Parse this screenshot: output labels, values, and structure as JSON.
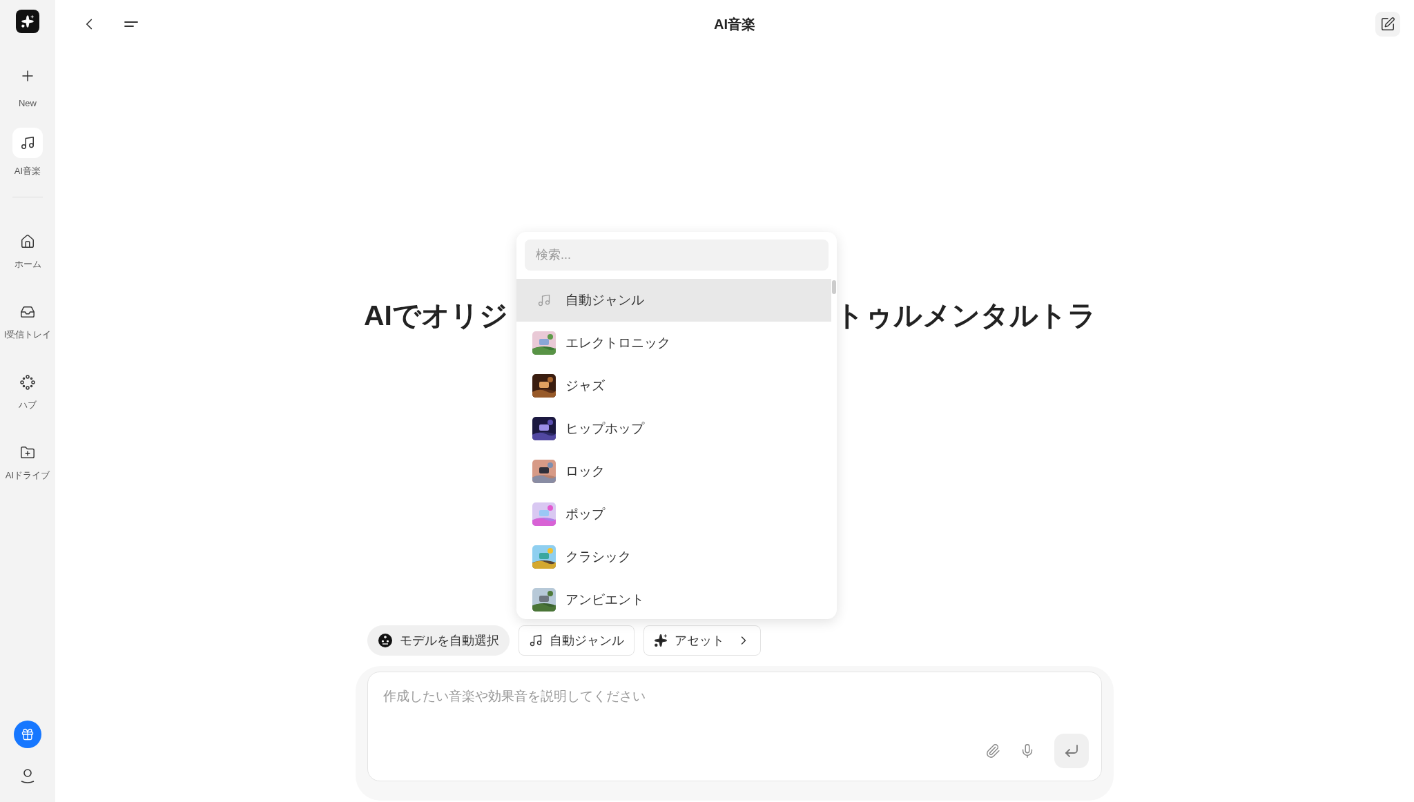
{
  "sidebar": {
    "top_items": [
      {
        "label": "New",
        "selected": false
      },
      {
        "label": "AI音楽",
        "selected": true
      }
    ],
    "nav_items": [
      {
        "label": "ホーム",
        "selected": false
      },
      {
        "label": "I受信トレイ",
        "selected": false
      },
      {
        "label": "ハブ",
        "selected": false
      },
      {
        "label": "AIドライブ",
        "selected": false
      }
    ]
  },
  "header": {
    "title": "AI音楽"
  },
  "heading": {
    "parts": [
      "AIでオリジ",
      "トゥルメンタルトラ"
    ]
  },
  "genre_menu": {
    "search_placeholder": "検索...",
    "items": [
      {
        "kind": "icon",
        "label": "自動ジャンル",
        "selected": true
      },
      {
        "kind": "picture",
        "label": "エレクトロニック",
        "selected": false
      },
      {
        "kind": "picture",
        "label": "ジャズ",
        "selected": false
      },
      {
        "kind": "picture",
        "label": "ヒップホップ",
        "selected": false
      },
      {
        "kind": "picture",
        "label": "ロック",
        "selected": false
      },
      {
        "kind": "picture",
        "label": "ポップ",
        "selected": false
      },
      {
        "kind": "picture",
        "label": "クラシック",
        "selected": false
      },
      {
        "kind": "picture",
        "label": "アンビエント",
        "selected": false
      }
    ]
  },
  "chips": [
    {
      "kind": "model",
      "label": "モデルを自動選択"
    },
    {
      "kind": "genre",
      "label": "自動ジャンル"
    },
    {
      "kind": "asset",
      "label": "アセット"
    }
  ],
  "composer": {
    "placeholder": "作成したい音楽や効果音を説明してください"
  }
}
